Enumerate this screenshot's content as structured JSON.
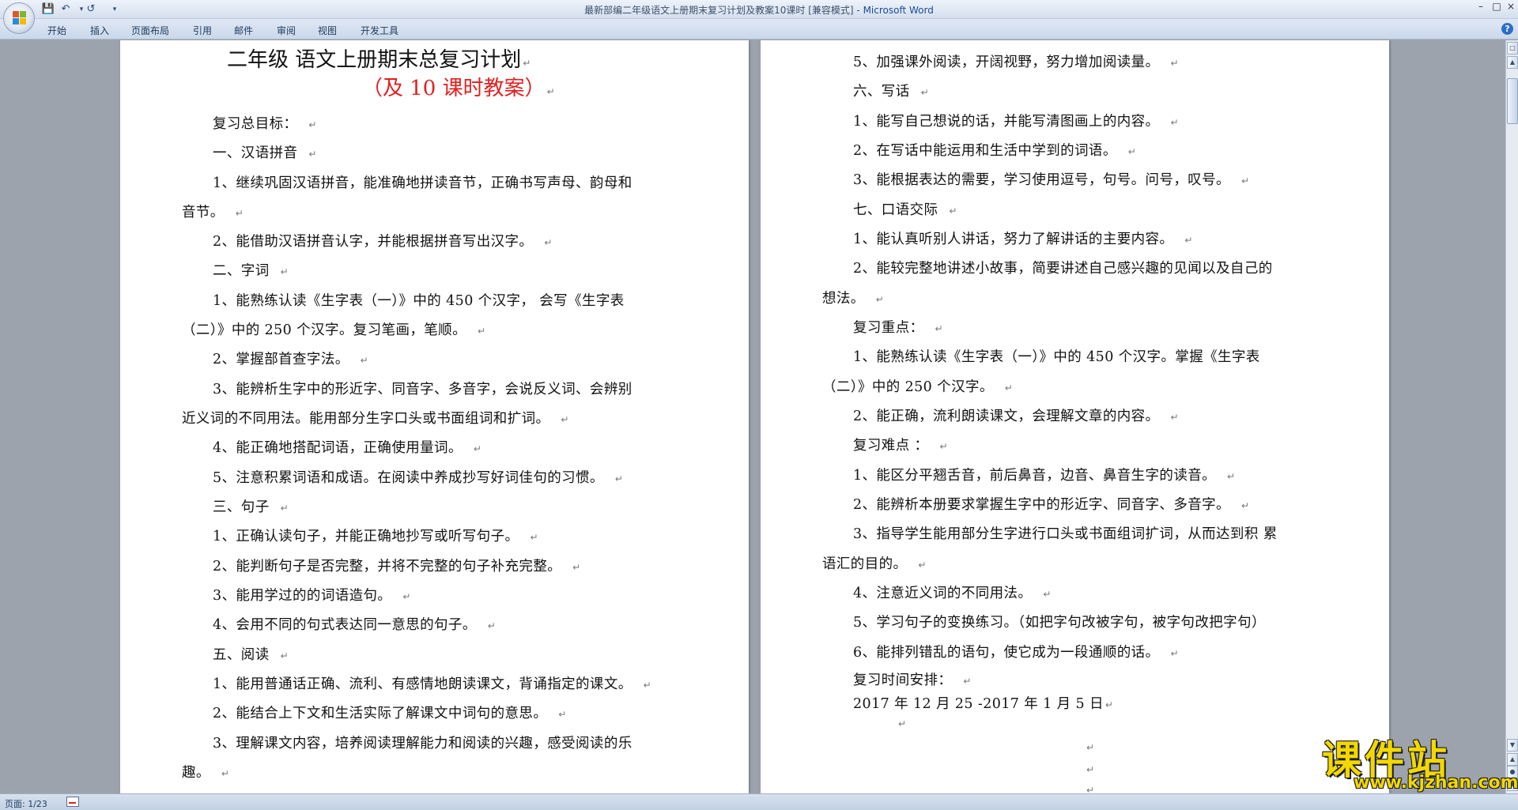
{
  "window": {
    "title": "最新部编二年级语文上册期末复习计划及教案10课时 [兼容模式]",
    "app_name": "Microsoft Word",
    "title_separator": " - ",
    "controls": [
      "–",
      "□",
      "×"
    ]
  },
  "quick_access": {
    "save_icon": "save-icon",
    "undo_icon": "undo-icon",
    "redo_icon": "redo-icon",
    "customize_icon": "customize-qat-icon"
  },
  "ribbon": {
    "tabs": [
      "开始",
      "插入",
      "页面布局",
      "引用",
      "邮件",
      "审阅",
      "视图",
      "开发工具"
    ],
    "help_label": "?"
  },
  "page1": {
    "title": "二年级 语文上册期末总复习计划",
    "subtitle": "（及 10 课时教案）",
    "lines": [
      "复习总目标：",
      "一、汉语拼音",
      "1、继续巩固汉语拼音，能准确地拼读音节，正确书写声母、韵母和",
      "音节。",
      "2、能借助汉语拼音认字，并能根据拼音写出汉字。",
      "二、字词",
      "1、能熟练认读《生字表（一）》中的 450 个汉字，  会写《生字表",
      "（二）》中的 250 个汉字。复习笔画，笔顺。",
      "2、掌握部首查字法。",
      "3、能辨析生字中的形近字、同音字、多音字，会说反义词、会辨别",
      "近义词的不同用法。能用部分生字口头或书面组词和扩词。",
      "4、能正确地搭配词语，正确使用量词。",
      "5、注意积累词语和成语。在阅读中养成抄写好词佳句的习惯。",
      "三、句子",
      "1、正确认读句子，并能正确地抄写或听写句子。",
      "2、能判断句子是否完整，并将不完整的句子补充完整。",
      "3、能用学过的的词语造句。",
      "4、会用不同的句式表达同一意思的句子。",
      "五、阅读",
      "1、能用普通话正确、流利、有感情地朗读课文，背诵指定的课文。",
      "2、能结合上下文和生活实际了解课文中词句的意思。",
      "3、理解课文内容，培养阅读理解能力和阅读的兴趣，感受阅读的乐",
      "趣。"
    ]
  },
  "page2": {
    "lines": [
      "5、加强课外阅读，开阔视野，努力增加阅读量。",
      "六、写话",
      "1、能写自己想说的话，并能写清图画上的内容。",
      "2、在写话中能运用和生活中学到的词语。",
      "3、能根据表达的需要，学习使用逗号，句号。问号，叹号。",
      "七、口语交际",
      "1、能认真听别人讲话，努力了解讲话的主要内容。",
      "2、能较完整地讲述小故事，简要讲述自己感兴趣的见闻以及自己的",
      "想法。",
      "复习重点：",
      "1、能熟练认读《生字表（一）》中的 450 个汉字。掌握《生字表",
      "（二）》中的 250 个汉字。",
      "2、能正确，流利朗读课文，会理解文章的内容。",
      "复习难点 ：",
      "1、能区分平翘舌音，前后鼻音，边音、鼻音生字的读音。",
      "2、能辨析本册要求掌握生字中的形近字、同音字、多音字。",
      "3、指导学生能用部分生字进行口头或书面组词扩词，从而达到积 累",
      "语汇的目的。",
      "4、注意近义词的不同用法。",
      "5、学习句子的变换练习。（如把字句改被字句，被字句改把字句）",
      "6、能排列错乱的语句，使它成为一段通顺的话。",
      "复习时间安排：",
      "2017 年 12 月 25 -2017 年 1 月 5 日"
    ],
    "paragraph_mark": "↵"
  },
  "statusbar": {
    "page_info": "页面: 1/23",
    "proofing_icon": "proofing-icon"
  },
  "watermark": {
    "name": "课件站",
    "url": "www.kjzhan.com"
  }
}
